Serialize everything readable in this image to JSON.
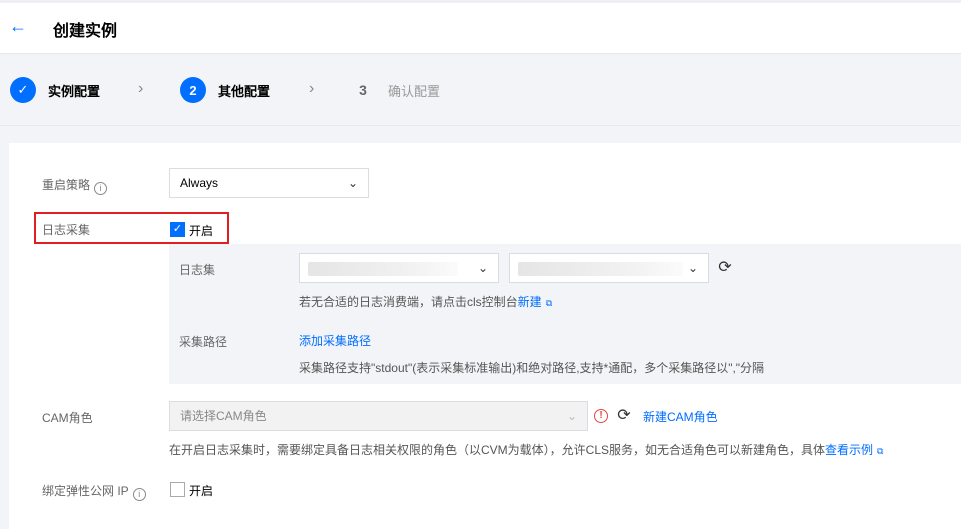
{
  "header": {
    "title": "创建实例",
    "back_icon": "arrow-left-icon"
  },
  "steps": [
    {
      "label": "实例配置",
      "state": "done"
    },
    {
      "number": "2",
      "label": "其他配置",
      "state": "active"
    },
    {
      "number": "3",
      "label": "确认配置",
      "state": "pending"
    }
  ],
  "restart": {
    "label": "重启策略",
    "value": "Always"
  },
  "log": {
    "label": "日志采集",
    "toggle_label": "开启",
    "checked": true,
    "logset_label": "日志集",
    "hint_prefix": "若无合适的日志消费端，请点击cls控制台",
    "hint_link": "新建",
    "path_label": "采集路径",
    "add_path": "添加采集路径",
    "path_hint": "采集路径支持\"stdout\"(表示采集标准输出)和绝对路径,支持*通配，多个采集路径以\",\"分隔"
  },
  "cam": {
    "label": "CAM角色",
    "placeholder": "请选择CAM角色",
    "new_link": "新建CAM角色",
    "hint": "在开启日志采集时，需要绑定具备日志相关权限的角色（以CVM为载体），允许CLS服务，如无合适角色可以新建角色，具体",
    "hint_link": "查看示例"
  },
  "eip": {
    "label": "绑定弹性公网 IP",
    "toggle_label": "开启",
    "checked": false
  },
  "colors": {
    "accent": "#006eff",
    "highlight": "#e02020",
    "warn": "#e54545"
  }
}
